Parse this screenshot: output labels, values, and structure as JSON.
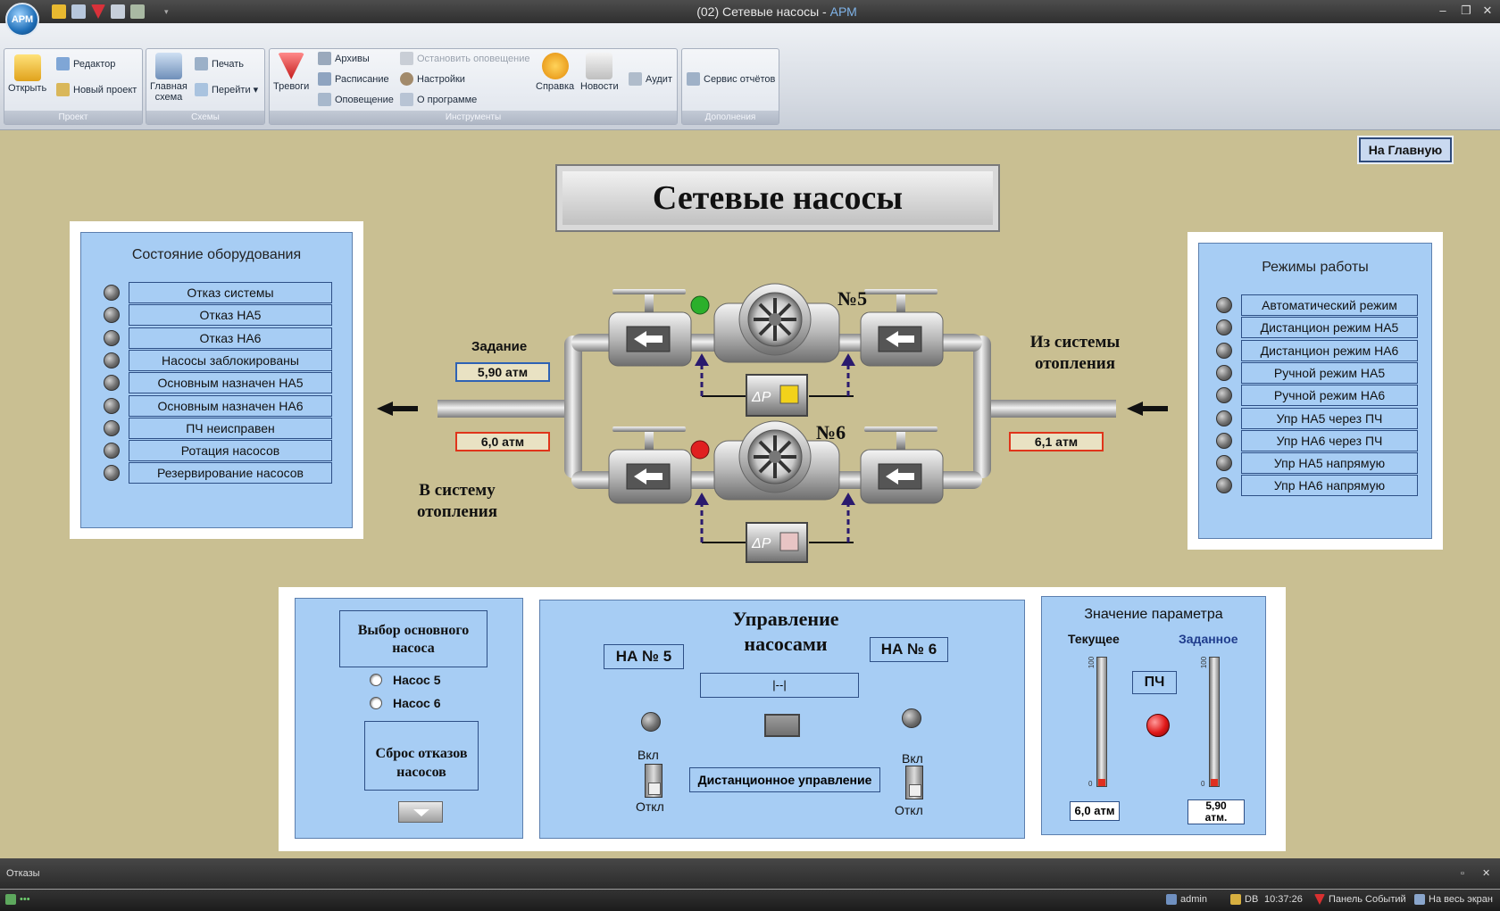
{
  "window": {
    "title_main": "(02) Сетевые насосы - ",
    "title_app": "АРМ",
    "logo": "АРМ"
  },
  "ribbon": {
    "groups": {
      "project": "Проект",
      "schemes": "Схемы",
      "tools": "Инструменты",
      "extras": "Дополнения"
    },
    "buttons": {
      "open": "Открыть",
      "editor": "Редактор",
      "new_project": "Новый проект",
      "main_scheme_1": "Главная",
      "main_scheme_2": "схема",
      "print": "Печать",
      "go_to": "Перейти ▾",
      "alarms": "Тревоги",
      "archives": "Архивы",
      "schedule": "Расписание",
      "notification": "Оповещение",
      "stop_notification": "Остановить оповещение",
      "settings": "Настройки",
      "about": "О программе",
      "help": "Справка",
      "news": "Новости",
      "audit": "Аудит",
      "report_service": "Сервис отчётов"
    }
  },
  "page": {
    "home_button": "На Главную",
    "title": "Сетевые насосы"
  },
  "equipment_state": {
    "title": "Состояние оборудования",
    "items": [
      "Отказ системы",
      "Отказ НА5",
      "Отказ НА6",
      "Насосы заблокированы",
      "Основным назначен НА5",
      "Основным назначен НА6",
      "ПЧ неисправен",
      "Ротация насосов",
      "Резервирование насосов"
    ]
  },
  "modes": {
    "title": "Режимы работы",
    "items": [
      "Автоматический режим",
      "Дистанцион режим НА5",
      "Дистанцион режим НА6",
      "Ручной режим НА5",
      "Ручной режим НА6",
      "Упр НА5 через ПЧ",
      "Упр НА6 через ПЧ",
      "Упр НА5 напрямую",
      "Упр НА6 напрямую"
    ]
  },
  "schematic": {
    "setpoint_label": "Задание",
    "setpoint_value": "5,90 атм",
    "outlet_pressure": "6,0 атм",
    "inlet_pressure": "6,1 атм",
    "to_system_1": "В систему",
    "to_system_2": "отопления",
    "from_system_1": "Из системы",
    "from_system_2": "отопления",
    "pump5_label": "№5",
    "pump6_label": "№6",
    "dp_label": "ΔP",
    "colors": {
      "pump5_status": "#2bb02b",
      "pump6_status": "#e02020",
      "dp5_indicator": "#f2d21a",
      "dp6_indicator": "#e8c4c4"
    }
  },
  "pump_select": {
    "title_1": "Выбор основного",
    "title_2": "насоса",
    "options": [
      "Насос 5",
      "Насос 6"
    ],
    "reset_1": "Сброс отказов",
    "reset_2": "насосов"
  },
  "pump_control": {
    "title_1": "Управление",
    "title_2": "насосами",
    "pump5": "НА № 5",
    "pump6": "НА № 6",
    "field_value": "|--|",
    "remote": "Дистанционное управление",
    "on": "Вкл",
    "off": "Откл"
  },
  "parameter": {
    "title": "Значение параметра",
    "current_label": "Текущее",
    "set_label": "Заданное",
    "vfd": "ПЧ",
    "current_value": "6,0 атм",
    "set_value_1": "5,90",
    "set_value_2": "атм.",
    "scale_max": "100",
    "scale_min": "0"
  },
  "bottom": {
    "faults": "Отказы",
    "user": "admin",
    "db": "DB",
    "time": "10:37:26",
    "events_panel": "Панель Событий",
    "fullscreen": "На весь экран"
  }
}
